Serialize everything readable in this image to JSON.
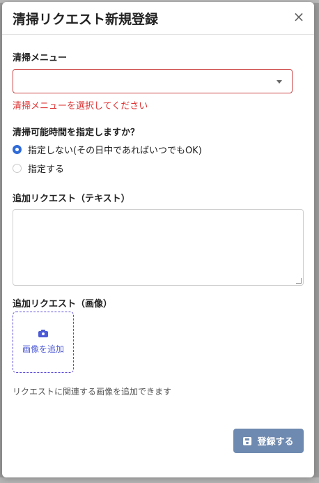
{
  "modal": {
    "title": "清掃リクエスト新規登録",
    "close_icon": "×"
  },
  "menu_field": {
    "label": "清掃メニュー",
    "value": "",
    "error": "清掃メニューを選択してください"
  },
  "time_field": {
    "label": "清掃可能時間を指定しますか？",
    "options": [
      {
        "label": "指定しない(その日中であればいつでもOK)",
        "selected": true
      },
      {
        "label": "指定する",
        "selected": false
      }
    ]
  },
  "text_request": {
    "label": "追加リクエスト（テキスト）",
    "value": ""
  },
  "image_request": {
    "label": "追加リクエスト（画像）",
    "upload_label": "画像を追加",
    "help": "リクエストに関連する画像を追加できます"
  },
  "submit": {
    "label": "登録する"
  },
  "colors": {
    "accent": "#2f6bd8",
    "error": "#dd3333",
    "upload": "#4e5bd6",
    "submit": "#6f8ab0"
  }
}
